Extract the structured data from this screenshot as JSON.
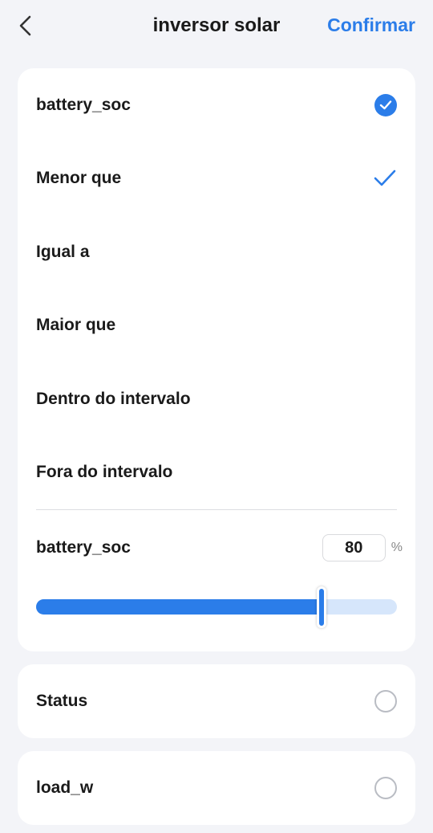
{
  "header": {
    "title": "inversor solar",
    "confirm_label": "Confirmar"
  },
  "main_card": {
    "parameter_label": "battery_soc",
    "parameter_selected": true,
    "options": [
      {
        "label": "Menor que",
        "selected": true
      },
      {
        "label": "Igual a",
        "selected": false
      },
      {
        "label": "Maior que",
        "selected": false
      },
      {
        "label": "Dentro do intervalo",
        "selected": false
      },
      {
        "label": "Fora do intervalo",
        "selected": false
      }
    ],
    "value_label": "battery_soc",
    "value": "80",
    "unit": "%",
    "slider_fraction": 0.79
  },
  "other_parameters": [
    {
      "label": "Status",
      "selected": false
    },
    {
      "label": "load_w",
      "selected": false
    }
  ],
  "colors": {
    "accent": "#2b7de9",
    "background": "#f3f4f8",
    "card": "#ffffff"
  },
  "icons": {
    "back": "chevron-left-icon",
    "checked_circle": "check-circle-icon",
    "check": "checkmark-icon",
    "radio": "radio-empty-icon"
  }
}
